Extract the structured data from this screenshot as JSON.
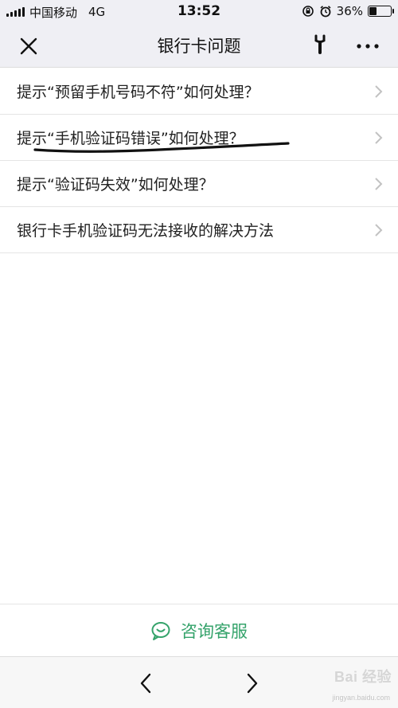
{
  "status_bar": {
    "carrier": "中国移动",
    "network": "4G",
    "time": "13:52",
    "battery_percent": "36%",
    "battery_level": 0.36
  },
  "nav": {
    "title": "银行卡问题",
    "close_icon": "close-icon",
    "wrench_icon": "wrench-icon",
    "more_icon": "more-icon"
  },
  "list": {
    "items": [
      {
        "label": "提示“预留手机号码不符”如何处理？"
      },
      {
        "label": "提示“手机验证码错误”如何处理？"
      },
      {
        "label": "提示“验证码失效”如何处理？"
      },
      {
        "label": "银行卡手机验证码无法接收的解决方法"
      }
    ]
  },
  "consult": {
    "label": "咨询客服",
    "color": "#35a36b",
    "icon": "chat-bubble-icon"
  },
  "bottom_nav": {
    "back_icon": "back-arrow-icon",
    "forward_icon": "forward-arrow-icon"
  },
  "watermark": {
    "logo": "Bai 经验",
    "sub": "jingyan.baidu.com"
  }
}
